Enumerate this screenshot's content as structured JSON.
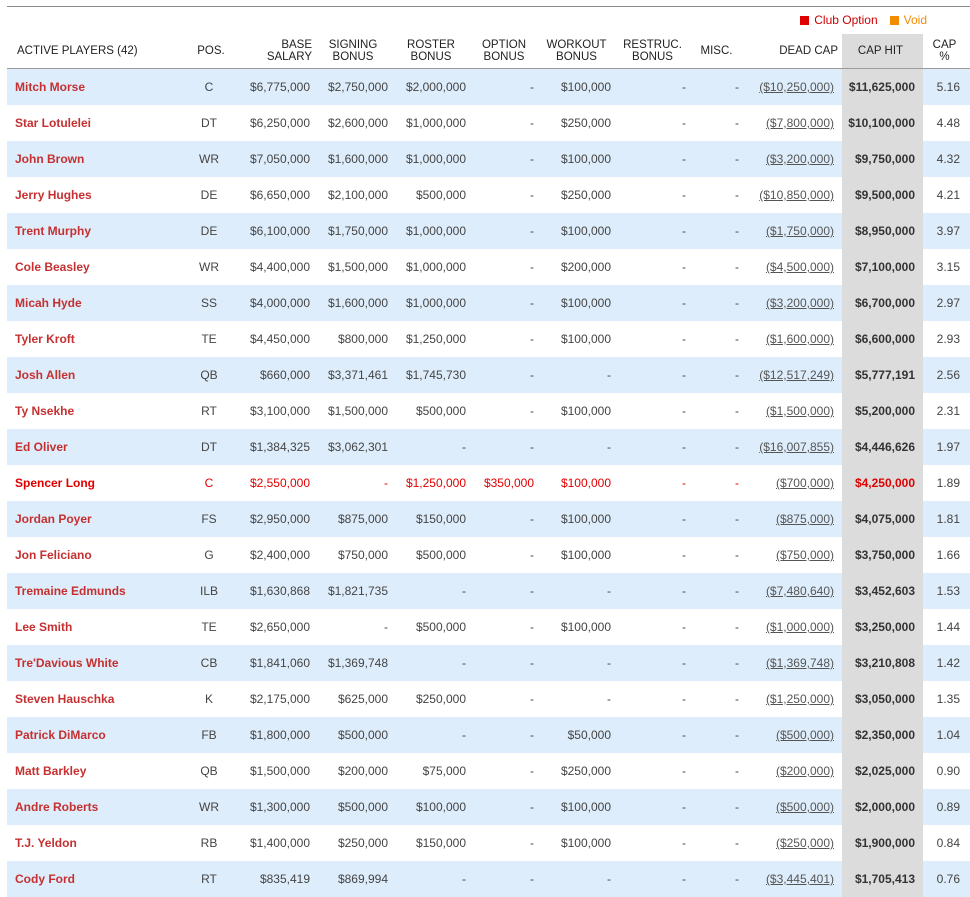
{
  "legend": {
    "club_option": "Club Option",
    "club_option_color": "#e00000",
    "void": "Void",
    "void_color": "#f28c00"
  },
  "table": {
    "columns": {
      "player": "ACTIVE PLAYERS (42)",
      "pos": "POS.",
      "base_salary": [
        "BASE",
        "SALARY"
      ],
      "signing_bonus": [
        "SIGNING",
        "BONUS"
      ],
      "roster_bonus": [
        "ROSTER",
        "BONUS"
      ],
      "option_bonus": [
        "OPTION",
        "BONUS"
      ],
      "workout_bonus": [
        "WORKOUT",
        "BONUS"
      ],
      "restruc_bonus": [
        "RESTRUC.",
        "BONUS"
      ],
      "misc": "MISC.",
      "dead_cap": "DEAD CAP",
      "cap_hit": "CAP HIT",
      "cap_pct": [
        "CAP",
        "%"
      ]
    },
    "rows": [
      {
        "name": "Mitch Morse",
        "pos": "C",
        "base": "$6,775,000",
        "signing": "$2,750,000",
        "roster": "$2,000,000",
        "option": "-",
        "workout": "$100,000",
        "restruc": "-",
        "misc": "-",
        "dead": "($10,250,000)",
        "cap_hit": "$11,625,000",
        "cap_pct": "5.16"
      },
      {
        "name": "Star Lotulelei",
        "pos": "DT",
        "base": "$6,250,000",
        "signing": "$2,600,000",
        "roster": "$1,000,000",
        "option": "-",
        "workout": "$250,000",
        "restruc": "-",
        "misc": "-",
        "dead": "($7,800,000)",
        "cap_hit": "$10,100,000",
        "cap_pct": "4.48"
      },
      {
        "name": "John Brown",
        "pos": "WR",
        "base": "$7,050,000",
        "signing": "$1,600,000",
        "roster": "$1,000,000",
        "option": "-",
        "workout": "$100,000",
        "restruc": "-",
        "misc": "-",
        "dead": "($3,200,000)",
        "cap_hit": "$9,750,000",
        "cap_pct": "4.32"
      },
      {
        "name": "Jerry Hughes",
        "pos": "DE",
        "base": "$6,650,000",
        "signing": "$2,100,000",
        "roster": "$500,000",
        "option": "-",
        "workout": "$250,000",
        "restruc": "-",
        "misc": "-",
        "dead": "($10,850,000)",
        "cap_hit": "$9,500,000",
        "cap_pct": "4.21"
      },
      {
        "name": "Trent Murphy",
        "pos": "DE",
        "base": "$6,100,000",
        "signing": "$1,750,000",
        "roster": "$1,000,000",
        "option": "-",
        "workout": "$100,000",
        "restruc": "-",
        "misc": "-",
        "dead": "($1,750,000)",
        "cap_hit": "$8,950,000",
        "cap_pct": "3.97"
      },
      {
        "name": "Cole Beasley",
        "pos": "WR",
        "base": "$4,400,000",
        "signing": "$1,500,000",
        "roster": "$1,000,000",
        "option": "-",
        "workout": "$200,000",
        "restruc": "-",
        "misc": "-",
        "dead": "($4,500,000)",
        "cap_hit": "$7,100,000",
        "cap_pct": "3.15"
      },
      {
        "name": "Micah Hyde",
        "pos": "SS",
        "base": "$4,000,000",
        "signing": "$1,600,000",
        "roster": "$1,000,000",
        "option": "-",
        "workout": "$100,000",
        "restruc": "-",
        "misc": "-",
        "dead": "($3,200,000)",
        "cap_hit": "$6,700,000",
        "cap_pct": "2.97"
      },
      {
        "name": "Tyler Kroft",
        "pos": "TE",
        "base": "$4,450,000",
        "signing": "$800,000",
        "roster": "$1,250,000",
        "option": "-",
        "workout": "$100,000",
        "restruc": "-",
        "misc": "-",
        "dead": "($1,600,000)",
        "cap_hit": "$6,600,000",
        "cap_pct": "2.93"
      },
      {
        "name": "Josh Allen",
        "pos": "QB",
        "base": "$660,000",
        "signing": "$3,371,461",
        "roster": "$1,745,730",
        "option": "-",
        "workout": "-",
        "restruc": "-",
        "misc": "-",
        "dead": "($12,517,249)",
        "cap_hit": "$5,777,191",
        "cap_pct": "2.56"
      },
      {
        "name": "Ty Nsekhe",
        "pos": "RT",
        "base": "$3,100,000",
        "signing": "$1,500,000",
        "roster": "$500,000",
        "option": "-",
        "workout": "$100,000",
        "restruc": "-",
        "misc": "-",
        "dead": "($1,500,000)",
        "cap_hit": "$5,200,000",
        "cap_pct": "2.31"
      },
      {
        "name": "Ed Oliver",
        "pos": "DT",
        "base": "$1,384,325",
        "signing": "$3,062,301",
        "roster": "-",
        "option": "-",
        "workout": "-",
        "restruc": "-",
        "misc": "-",
        "dead": "($16,007,855)",
        "cap_hit": "$4,446,626",
        "cap_pct": "1.97"
      },
      {
        "name": "Spencer Long",
        "pos": "C",
        "base": "$2,550,000",
        "signing": "-",
        "roster": "$1,250,000",
        "option": "$350,000",
        "workout": "$100,000",
        "restruc": "-",
        "misc": "-",
        "dead": "($700,000)",
        "cap_hit": "$4,250,000",
        "cap_pct": "1.89",
        "status": "void"
      },
      {
        "name": "Jordan Poyer",
        "pos": "FS",
        "base": "$2,950,000",
        "signing": "$875,000",
        "roster": "$150,000",
        "option": "-",
        "workout": "$100,000",
        "restruc": "-",
        "misc": "-",
        "dead": "($875,000)",
        "cap_hit": "$4,075,000",
        "cap_pct": "1.81"
      },
      {
        "name": "Jon Feliciano",
        "pos": "G",
        "base": "$2,400,000",
        "signing": "$750,000",
        "roster": "$500,000",
        "option": "-",
        "workout": "$100,000",
        "restruc": "-",
        "misc": "-",
        "dead": "($750,000)",
        "cap_hit": "$3,750,000",
        "cap_pct": "1.66"
      },
      {
        "name": "Tremaine Edmunds",
        "pos": "ILB",
        "base": "$1,630,868",
        "signing": "$1,821,735",
        "roster": "-",
        "option": "-",
        "workout": "-",
        "restruc": "-",
        "misc": "-",
        "dead": "($7,480,640)",
        "cap_hit": "$3,452,603",
        "cap_pct": "1.53"
      },
      {
        "name": "Lee Smith",
        "pos": "TE",
        "base": "$2,650,000",
        "signing": "-",
        "roster": "$500,000",
        "option": "-",
        "workout": "$100,000",
        "restruc": "-",
        "misc": "-",
        "dead": "($1,000,000)",
        "cap_hit": "$3,250,000",
        "cap_pct": "1.44"
      },
      {
        "name": "Tre'Davious White",
        "pos": "CB",
        "base": "$1,841,060",
        "signing": "$1,369,748",
        "roster": "-",
        "option": "-",
        "workout": "-",
        "restruc": "-",
        "misc": "-",
        "dead": "($1,369,748)",
        "cap_hit": "$3,210,808",
        "cap_pct": "1.42"
      },
      {
        "name": "Steven Hauschka",
        "pos": "K",
        "base": "$2,175,000",
        "signing": "$625,000",
        "roster": "$250,000",
        "option": "-",
        "workout": "-",
        "restruc": "-",
        "misc": "-",
        "dead": "($1,250,000)",
        "cap_hit": "$3,050,000",
        "cap_pct": "1.35"
      },
      {
        "name": "Patrick DiMarco",
        "pos": "FB",
        "base": "$1,800,000",
        "signing": "$500,000",
        "roster": "-",
        "option": "-",
        "workout": "$50,000",
        "restruc": "-",
        "misc": "-",
        "dead": "($500,000)",
        "cap_hit": "$2,350,000",
        "cap_pct": "1.04"
      },
      {
        "name": "Matt Barkley",
        "pos": "QB",
        "base": "$1,500,000",
        "signing": "$200,000",
        "roster": "$75,000",
        "option": "-",
        "workout": "$250,000",
        "restruc": "-",
        "misc": "-",
        "dead": "($200,000)",
        "cap_hit": "$2,025,000",
        "cap_pct": "0.90"
      },
      {
        "name": "Andre Roberts",
        "pos": "WR",
        "base": "$1,300,000",
        "signing": "$500,000",
        "roster": "$100,000",
        "option": "-",
        "workout": "$100,000",
        "restruc": "-",
        "misc": "-",
        "dead": "($500,000)",
        "cap_hit": "$2,000,000",
        "cap_pct": "0.89"
      },
      {
        "name": "T.J. Yeldon",
        "pos": "RB",
        "base": "$1,400,000",
        "signing": "$250,000",
        "roster": "$150,000",
        "option": "-",
        "workout": "$100,000",
        "restruc": "-",
        "misc": "-",
        "dead": "($250,000)",
        "cap_hit": "$1,900,000",
        "cap_pct": "0.84"
      },
      {
        "name": "Cody Ford",
        "pos": "RT",
        "base": "$835,419",
        "signing": "$869,994",
        "roster": "-",
        "option": "-",
        "workout": "-",
        "restruc": "-",
        "misc": "-",
        "dead": "($3,445,401)",
        "cap_hit": "$1,705,413",
        "cap_pct": "0.76"
      }
    ]
  }
}
